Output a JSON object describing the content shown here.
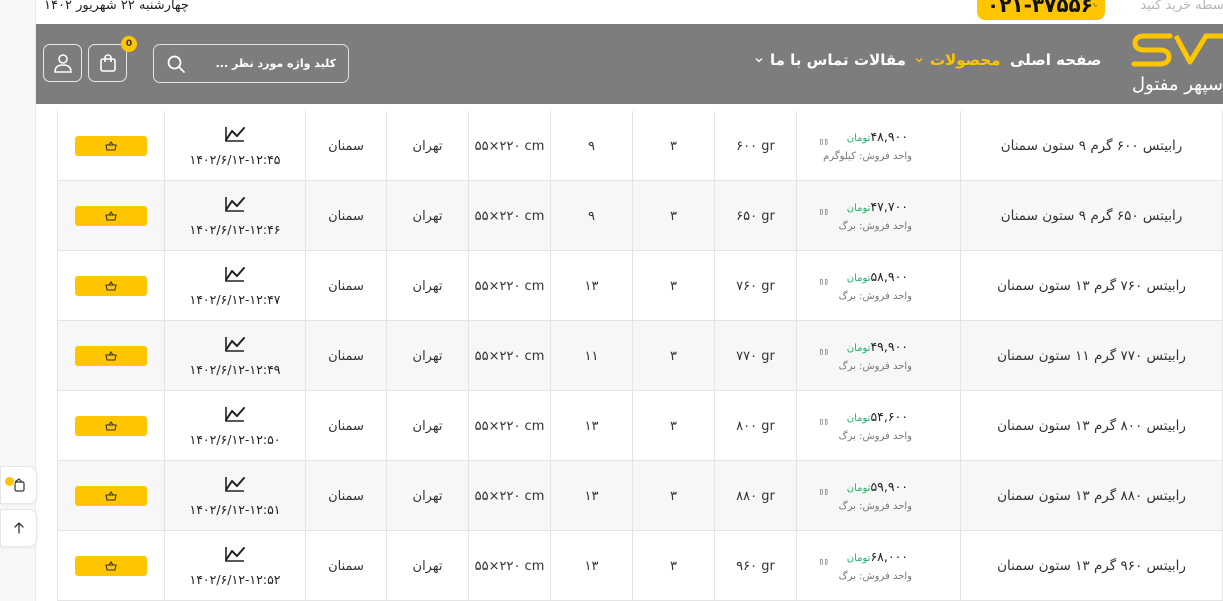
{
  "top_bar": {
    "date": "چهارشنبه ۲۲ شهریور ۱۴۰۲",
    "phone": "۰۲۱-۳۷۵۵۶",
    "buy_text": "بدون واسطه خرید کنید"
  },
  "header": {
    "cart_count": "0",
    "search_placeholder": "کلید واژه مورد نظر ...",
    "nav": {
      "home": "صفحه اصلی",
      "products": "محصولات",
      "articles": "مقالات",
      "contact": "تماس با ما"
    },
    "logo_tagline": "سپهر مفتول"
  },
  "colors": {
    "accent": "#ffc600",
    "header_bg": "#7d7d7d",
    "price_unit": "#1bb36a"
  },
  "table": {
    "rows": [
      {
        "name": "رابیتس ۶۰۰ گرم ۹ ستون سمنان",
        "price": "۴۸,۹۰۰",
        "unit": "تومان",
        "sale_unit": "واحد فروش: کیلوگرم",
        "weight": "۶۰۰ gr",
        "q": "۳",
        "cols": "۹",
        "dim": "۵۵×۲۲۰ cm",
        "city": "تهران",
        "factory": "سمنان",
        "date": "۱۴۰۲/۶/۱۲-۱۲:۴۵"
      },
      {
        "name": "رابیتس ۶۵۰ گرم ۹ ستون سمنان",
        "price": "۴۷,۷۰۰",
        "unit": "تومان",
        "sale_unit": "واحد فروش: برگ",
        "weight": "۶۵۰ gr",
        "q": "۳",
        "cols": "۹",
        "dim": "۵۵×۲۲۰ cm",
        "city": "تهران",
        "factory": "سمنان",
        "date": "۱۴۰۲/۶/۱۲-۱۲:۴۶"
      },
      {
        "name": "رابیتس ۷۶۰ گرم ۱۳ ستون سمنان",
        "price": "۵۸,۹۰۰",
        "unit": "تومان",
        "sale_unit": "واحد فروش: برگ",
        "weight": "۷۶۰ gr",
        "q": "۳",
        "cols": "۱۳",
        "dim": "۵۵×۲۲۰ cm",
        "city": "تهران",
        "factory": "سمنان",
        "date": "۱۴۰۲/۶/۱۲-۱۲:۴۷"
      },
      {
        "name": "رابیتس ۷۷۰ گرم ۱۱ ستون سمنان",
        "price": "۴۹,۹۰۰",
        "unit": "تومان",
        "sale_unit": "واحد فروش: برگ",
        "weight": "۷۷۰ gr",
        "q": "۳",
        "cols": "۱۱",
        "dim": "۵۵×۲۲۰ cm",
        "city": "تهران",
        "factory": "سمنان",
        "date": "۱۴۰۲/۶/۱۲-۱۲:۴۹"
      },
      {
        "name": "رابیتس ۸۰۰ گرم ۱۳ ستون سمنان",
        "price": "۵۴,۶۰۰",
        "unit": "تومان",
        "sale_unit": "واحد فروش: برگ",
        "weight": "۸۰۰ gr",
        "q": "۳",
        "cols": "۱۳",
        "dim": "۵۵×۲۲۰ cm",
        "city": "تهران",
        "factory": "سمنان",
        "date": "۱۴۰۲/۶/۱۲-۱۲:۵۰"
      },
      {
        "name": "رابیتس ۸۸۰ گرم ۱۳ ستون سمنان",
        "price": "۵۹,۹۰۰",
        "unit": "تومان",
        "sale_unit": "واحد فروش: برگ",
        "weight": "۸۸۰ gr",
        "q": "۳",
        "cols": "۱۳",
        "dim": "۵۵×۲۲۰ cm",
        "city": "تهران",
        "factory": "سمنان",
        "date": "۱۴۰۲/۶/۱۲-۱۲:۵۱"
      },
      {
        "name": "رابیتس ۹۶۰ گرم ۱۳ ستون سمنان",
        "price": "۶۸,۰۰۰",
        "unit": "تومان",
        "sale_unit": "واحد فروش: برگ",
        "weight": "۹۶۰ gr",
        "q": "۳",
        "cols": "۱۳",
        "dim": "۵۵×۲۲۰ cm",
        "city": "تهران",
        "factory": "سمنان",
        "date": "۱۴۰۲/۶/۱۲-۱۲:۵۲"
      }
    ]
  }
}
